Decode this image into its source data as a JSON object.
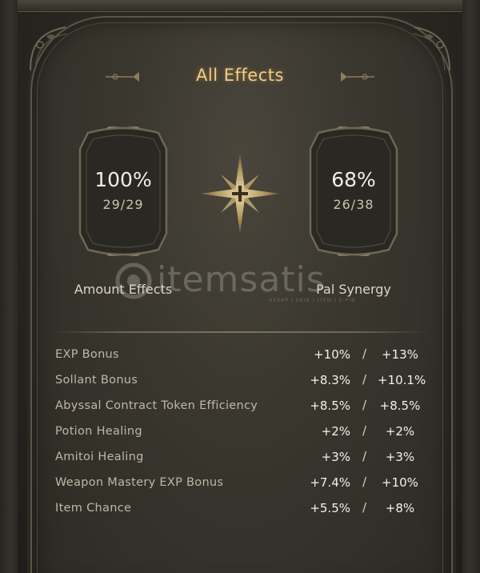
{
  "title": "All Effects",
  "amount_effects": {
    "percent": "100%",
    "count": "29/29",
    "label": "Amount Effects"
  },
  "pal_synergy": {
    "percent": "68%",
    "count": "26/38",
    "label": "Pal Synergy"
  },
  "watermark": {
    "text": "itemsatis",
    "sub": "HESAP / SKIN / ITEM / E-PIN"
  },
  "effects": [
    {
      "name": "EXP Bonus",
      "value_1": "+10%",
      "separator": "/",
      "value_2": "+13%"
    },
    {
      "name": "Sollant Bonus",
      "value_1": "+8.3%",
      "separator": "/",
      "value_2": "+10.1%"
    },
    {
      "name": "Abyssal Contract Token Efficiency",
      "value_1": "+8.5%",
      "separator": "/",
      "value_2": "+8.5%"
    },
    {
      "name": "Potion Healing",
      "value_1": "+2%",
      "separator": "/",
      "value_2": "+2%"
    },
    {
      "name": "Amitoi Healing",
      "value_1": "+3%",
      "separator": "/",
      "value_2": "+3%"
    },
    {
      "name": "Weapon Mastery EXP Bonus",
      "value_1": "+7.4%",
      "separator": "/",
      "value_2": "+10%"
    },
    {
      "name": "Item Chance",
      "value_1": "+5.5%",
      "separator": "/",
      "value_2": "+8%"
    }
  ],
  "colors": {
    "title": "#f0cd86",
    "value": "#f4f1ea",
    "label": "#bfb8a8",
    "ornament": "#8a7d60"
  }
}
